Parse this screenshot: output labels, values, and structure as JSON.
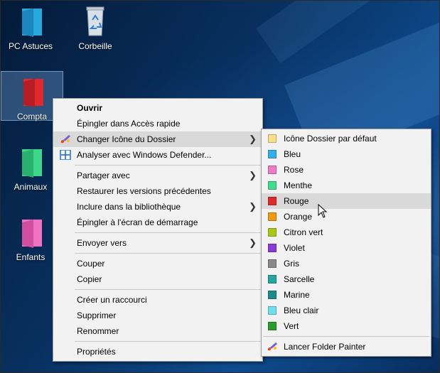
{
  "desktop": {
    "icons": [
      {
        "label": "PC Astuces",
        "color": "#29a8e0"
      },
      {
        "label": "Corbeille",
        "color": "#cfd6de"
      },
      {
        "label": "Compta",
        "color": "#e0282e"
      },
      {
        "label": "Animaux",
        "color": "#3ed68a"
      },
      {
        "label": "Enfants",
        "color": "#f072c0"
      }
    ]
  },
  "context_menu": {
    "open": "Ouvrir",
    "pin_quick": "Épingler dans Accès rapide",
    "change_icon": "Changer Icône du Dossier",
    "defender": "Analyser avec Windows Defender...",
    "share": "Partager avec",
    "restore": "Restaurer les versions précédentes",
    "library": "Inclure dans la bibliothèque",
    "pin_start": "Épingler à l'écran de démarrage",
    "send_to": "Envoyer vers",
    "cut": "Couper",
    "copy": "Copier",
    "shortcut": "Créer un raccourci",
    "delete": "Supprimer",
    "rename": "Renommer",
    "properties": "Propriétés"
  },
  "submenu": {
    "items": [
      {
        "label": "Icône Dossier par défaut",
        "color": "#f8e08a"
      },
      {
        "label": "Bleu",
        "color": "#2fb0ea"
      },
      {
        "label": "Rose",
        "color": "#f27ac6"
      },
      {
        "label": "Menthe",
        "color": "#3fdc92"
      },
      {
        "label": "Rouge",
        "color": "#e02a2a"
      },
      {
        "label": "Orange",
        "color": "#f39a12"
      },
      {
        "label": "Citron vert",
        "color": "#a8c818"
      },
      {
        "label": "Violet",
        "color": "#8a3ad8"
      },
      {
        "label": "Gris",
        "color": "#8a8a8a"
      },
      {
        "label": "Sarcelle",
        "color": "#23a6a0"
      },
      {
        "label": "Marine",
        "color": "#1e8a8a"
      },
      {
        "label": "Bleu clair",
        "color": "#6ee0f2"
      },
      {
        "label": "Vert",
        "color": "#2a9e2a"
      }
    ],
    "launcher": "Lancer Folder Painter",
    "highlighted": "Rouge"
  }
}
